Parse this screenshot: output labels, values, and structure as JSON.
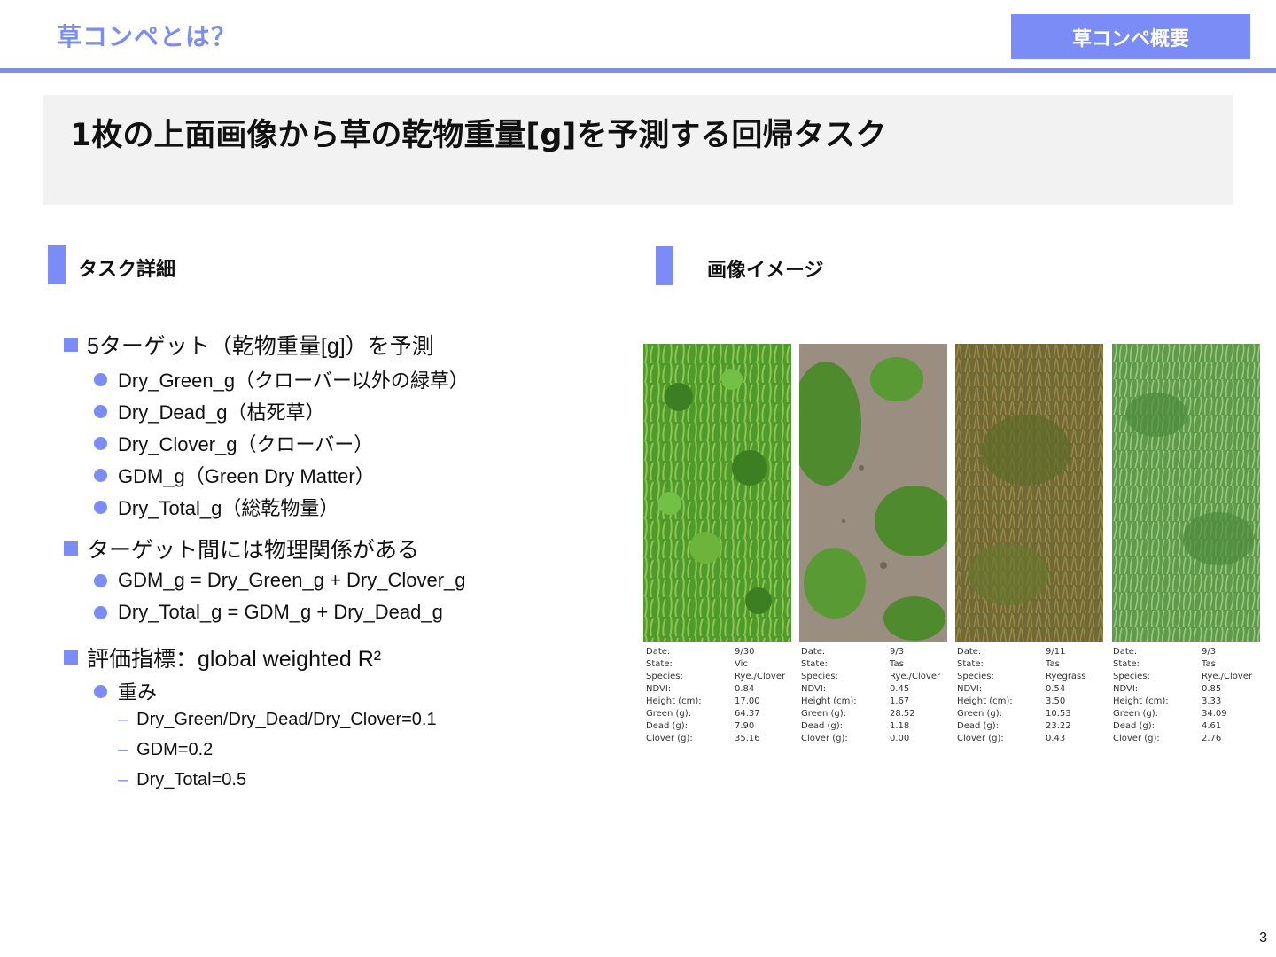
{
  "header": {
    "title": "草コンペとは？",
    "badge": "草コンペ概要"
  },
  "headline": "1枚の上面画像から草の乾物重量[g]を予測する回帰タスク",
  "sections": {
    "left_title": "タスク詳細",
    "right_title": "画像イメージ"
  },
  "task": {
    "b1": "5ターゲット（乾物重量[g]）を予測",
    "b1_items": [
      "Dry_Green_g（クローバー以外の緑草）",
      "Dry_Dead_g（枯死草）",
      "Dry_Clover_g（クローバー）",
      "GDM_g（Green Dry Matter）",
      "Dry_Total_g（総乾物量）"
    ],
    "b2": "ターゲット間には物理関係がある",
    "b2_items": [
      "GDM_g = Dry_Green_g + Dry_Clover_g",
      "Dry_Total_g = GDM_g + Dry_Dead_g"
    ],
    "b3": "評価指標：global weighted R²",
    "b3_items": [
      "重み"
    ],
    "b3_sub": [
      "Dry_Green/Dry_Dead/Dry_Clover=0.1",
      "GDM=0.2",
      "Dry_Total=0.5"
    ]
  },
  "caption_labels": [
    "Date:",
    "State:",
    "Species:",
    "NDVI:",
    "Height (cm):",
    "Green (g):",
    "Dead (g):",
    "Clover (g):"
  ],
  "samples": [
    {
      "values": [
        "9/30",
        "Vic",
        "Rye./Clover",
        "0.84",
        "17.00",
        "64.37",
        "7.90",
        "35.16"
      ]
    },
    {
      "values": [
        "9/3",
        "Tas",
        "Rye./Clover",
        "0.45",
        "1.67",
        "28.52",
        "1.18",
        "0.00"
      ]
    },
    {
      "values": [
        "9/11",
        "Tas",
        "Ryegrass",
        "0.54",
        "3.50",
        "10.53",
        "23.22",
        "0.43"
      ]
    },
    {
      "values": [
        "9/3",
        "Tas",
        "Rye./Clover",
        "0.85",
        "3.33",
        "34.09",
        "4.61",
        "2.76"
      ]
    }
  ],
  "page_number": "3",
  "colors": {
    "accent": "#7b8cf6",
    "headline_bg": "#f2f2f2"
  }
}
